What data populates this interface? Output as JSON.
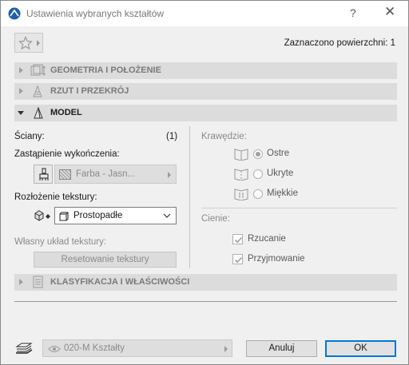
{
  "window": {
    "title": "Ustawienia wybranych kształtów",
    "help_label": "?",
    "close_label": "✕"
  },
  "toolbar": {
    "selection_info": "Zaznaczono powierzchni: 1"
  },
  "sections": {
    "geometry": "GEOMETRIA I POŁOŻENIE",
    "plan": "RZUT I PRZEKRÓJ",
    "model": "MODEL",
    "classification": "KLASYFIKACJA I WŁAŚCIWOŚCI"
  },
  "model": {
    "walls_label": "Ściany:",
    "walls_count": "(1)",
    "finish_override_label": "Zastąpienie wykończenia:",
    "finish_value": "Farba - Jasn...",
    "texture_mapping_label": "Rozłożenie tekstury:",
    "texture_mapping_value": "Prostopadłe",
    "custom_texture_label": "Własny układ tekstury:",
    "reset_texture_label": "Resetowanie tekstury",
    "edges_label": "Krawędzie:",
    "edges": [
      {
        "label": "Ostre",
        "selected": true
      },
      {
        "label": "Ukryte",
        "selected": false
      },
      {
        "label": "Miękkie",
        "selected": false
      }
    ],
    "shadows_label": "Cienie:",
    "shadows": [
      {
        "label": "Rzucanie",
        "checked": true
      },
      {
        "label": "Przyjmowanie",
        "checked": true
      }
    ]
  },
  "footer": {
    "layer_value": "020-M Kształty",
    "cancel_label": "Anuluj",
    "ok_label": "OK"
  },
  "colors": {
    "accent": "#0078d7",
    "section_bg": "#dcdcdc",
    "dialog_bg": "#f0f0f0"
  }
}
